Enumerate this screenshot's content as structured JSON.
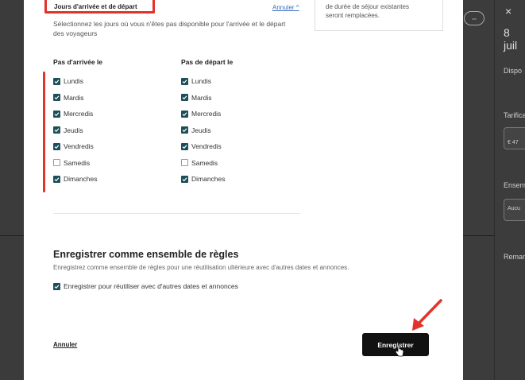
{
  "section": {
    "pill_label": "Jours d'arrivée et de départ",
    "cancel_top": "Annuler ^",
    "description_line1": "Sélectionnez les jours où vous n'êtes pas disponible pour l'arrivée et le départ",
    "description_line2": "des voyageurs"
  },
  "info_box": {
    "line1": "de durée de séjour existantes",
    "line2": "seront remplacées."
  },
  "arrival": {
    "heading": "Pas d'arrivée le",
    "days": [
      {
        "label": "Lundis",
        "checked": true
      },
      {
        "label": "Mardis",
        "checked": true
      },
      {
        "label": "Mercredis",
        "checked": true
      },
      {
        "label": "Jeudis",
        "checked": true
      },
      {
        "label": "Vendredis",
        "checked": true
      },
      {
        "label": "Samedis",
        "checked": false
      },
      {
        "label": "Dimanches",
        "checked": true
      }
    ]
  },
  "departure": {
    "heading": "Pas de départ le",
    "days": [
      {
        "label": "Lundis",
        "checked": true
      },
      {
        "label": "Mardis",
        "checked": true
      },
      {
        "label": "Mercredis",
        "checked": true
      },
      {
        "label": "Jeudis",
        "checked": true
      },
      {
        "label": "Vendredis",
        "checked": true
      },
      {
        "label": "Samedis",
        "checked": false
      },
      {
        "label": "Dimanches",
        "checked": true
      }
    ]
  },
  "ruleset": {
    "title": "Enregistrer comme ensemble de règles",
    "subtitle": "Enregistrez comme ensemble de règles pour une réutilisation ultérieure avec d'autres dates et annonces.",
    "checkbox_label": "Enregistrer pour réutiliser avec d'autres dates et annonces",
    "checkbox_checked": true
  },
  "footer": {
    "cancel_label": "Annuler",
    "save_label": "Enregistrer"
  },
  "background": {
    "right_date": "8 juil",
    "right_item1": "Dispo",
    "right_item2": "Tarifica",
    "right_item3": "Ensem",
    "right_item4": "Remar",
    "right_input_value": "€ 47",
    "right_select_value": "Aucu",
    "close_icon": "×"
  },
  "colors": {
    "checkbox_on": "#1d4f5a",
    "highlight_red": "#e4322b",
    "save_button": "#111111",
    "link_blue": "#3b6fbf"
  }
}
